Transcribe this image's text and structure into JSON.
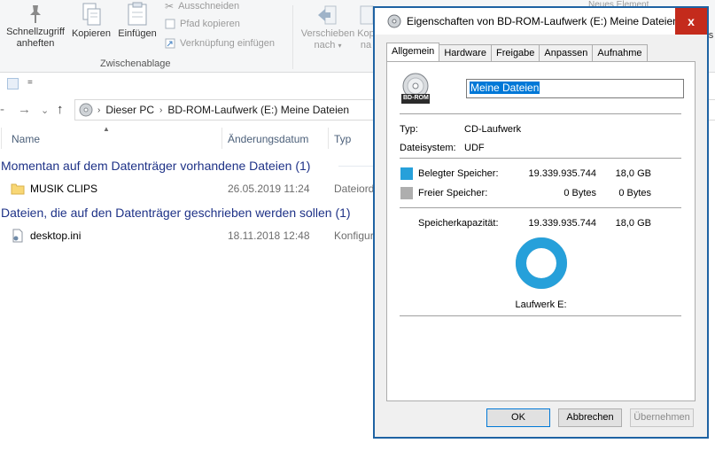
{
  "ribbon": {
    "pin_label_1": "Schnellzugriff",
    "pin_label_2": "anheften",
    "copy_label": "Kopieren",
    "paste_label": "Einfügen",
    "cut_label": "Ausschneiden",
    "copy_path_label": "Pfad kopieren",
    "paste_shortcut_label": "Verknüpfung einfügen",
    "clipboard_group": "Zwischenablage",
    "move_label_1": "Verschieben",
    "move_label_2": "nach",
    "copyto_label_1": "Kop",
    "copyto_label_2": "na",
    "new_element_label": "Neues Element",
    "right_edge_label": "s"
  },
  "quick_access": {
    "arrow": "="
  },
  "address": {
    "segments": [
      "Dieser PC",
      "BD-ROM-Laufwerk (E:) Meine Dateien"
    ]
  },
  "columns": {
    "name": "Name",
    "date": "Änderungsdatum",
    "type": "Typ"
  },
  "groups": [
    {
      "title": "Momentan auf dem Datenträger vorhandene Dateien (1)",
      "items": [
        {
          "name": "MUSIK CLIPS",
          "date": "26.05.2019 11:24",
          "type": "Dateiord"
        }
      ]
    },
    {
      "title": "Dateien, die auf den Datenträger geschrieben werden sollen (1)",
      "items": [
        {
          "name": "desktop.ini",
          "date": "18.11.2018 12:48",
          "type": "Konfigur"
        }
      ]
    }
  ],
  "dialog": {
    "title": "Eigenschaften von BD-ROM-Laufwerk (E:) Meine Dateien",
    "close": "x",
    "tabs": [
      "Allgemein",
      "Hardware",
      "Freigabe",
      "Anpassen",
      "Aufnahme"
    ],
    "drive_icon_text": "BD-ROM",
    "name_value": "Meine Dateien",
    "type_label": "Typ:",
    "type_value": "CD-Laufwerk",
    "fs_label": "Dateisystem:",
    "fs_value": "UDF",
    "used_label": "Belegter Speicher:",
    "used_bytes": "19.339.935.744",
    "used_gb": "18,0 GB",
    "free_label": "Freier Speicher:",
    "free_bytes": "0 Bytes",
    "free_gb": "0 Bytes",
    "capacity_label": "Speicherkapazität:",
    "capacity_bytes": "19.339.935.744",
    "capacity_gb": "18,0 GB",
    "drive_label": "Laufwerk E:",
    "used_fraction": 1.0,
    "colors": {
      "used": "#26a0da",
      "free": "#aeaeae"
    },
    "buttons": {
      "ok": "OK",
      "cancel": "Abbrechen",
      "apply": "Übernehmen"
    }
  }
}
